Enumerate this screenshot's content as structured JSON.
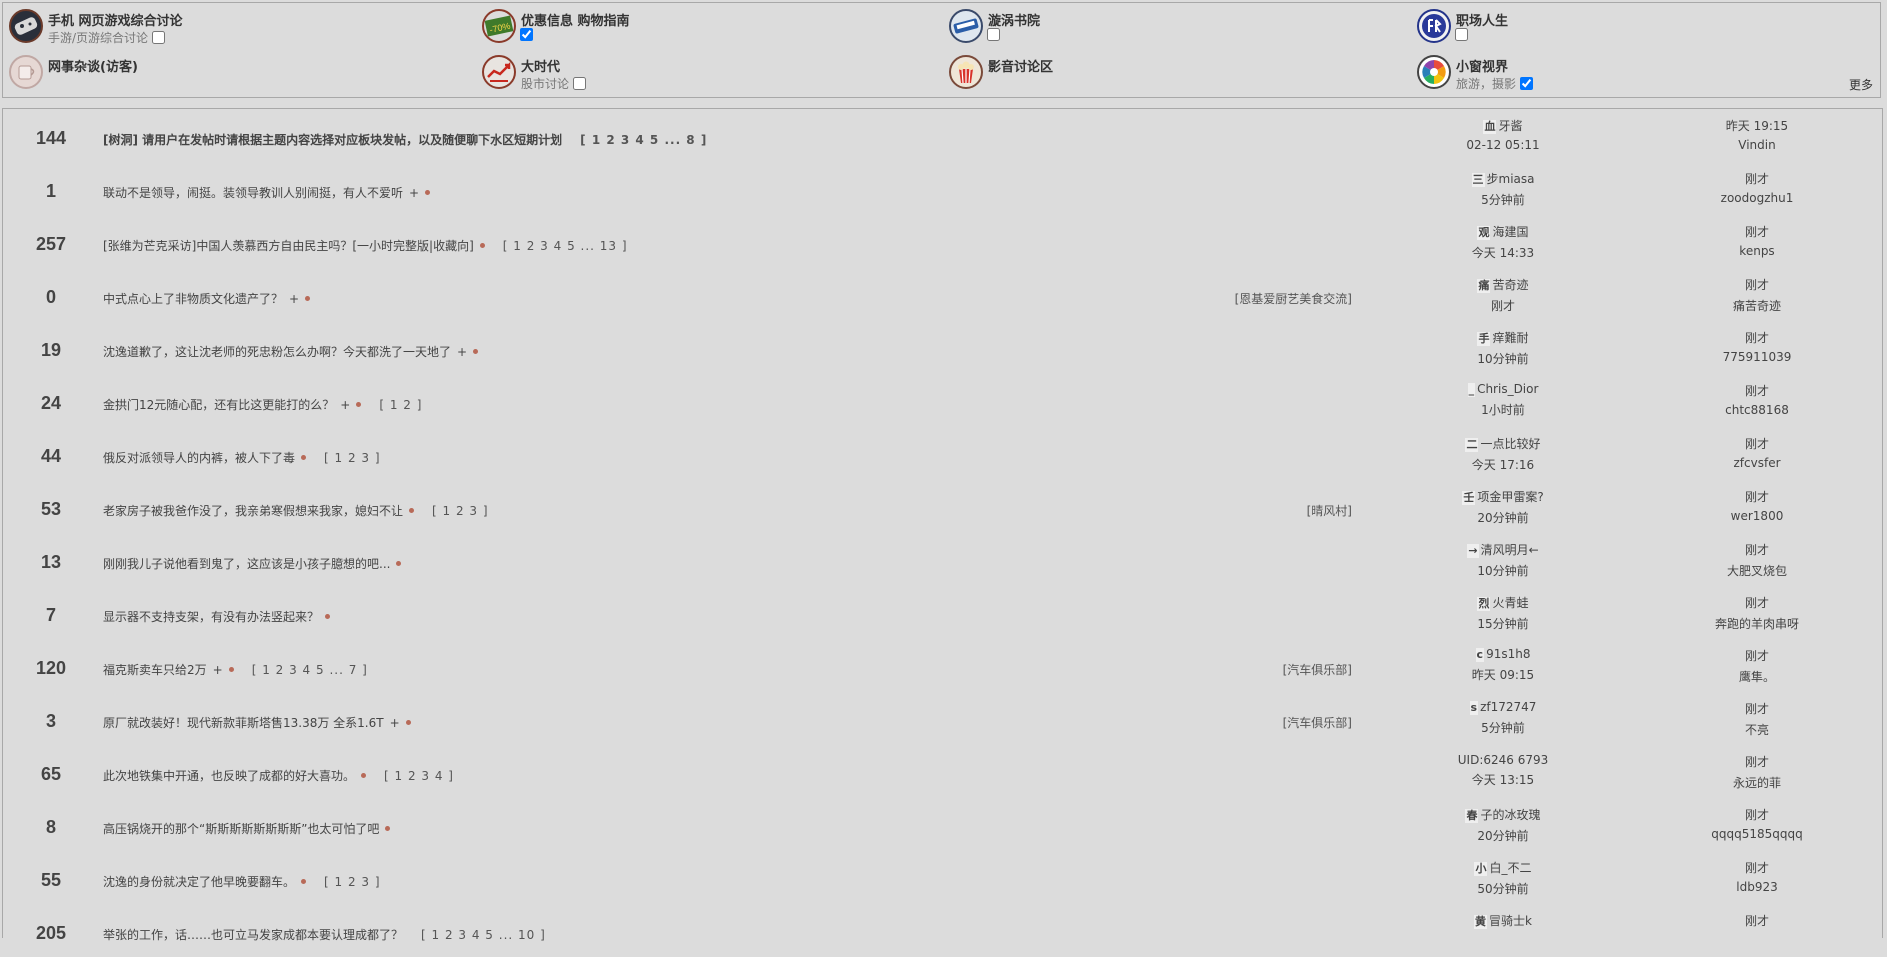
{
  "forums": [
    {
      "name": "手机 网页游戏综合讨论",
      "sub": "手游/页游综合讨论",
      "checked": false,
      "icon": "gamepad-icon"
    },
    {
      "name": "优惠信息 购物指南",
      "sub": "",
      "checked": true,
      "icon": "discount-tag-icon",
      "badge": "-70%"
    },
    {
      "name": "漩涡书院",
      "sub": "",
      "checked": false,
      "icon": "book-icon"
    },
    {
      "name": "职场人生",
      "sub": "",
      "checked": false,
      "icon": "career-icon"
    },
    {
      "name": "网事杂谈(访客)",
      "sub": "",
      "icon": "cup-icon"
    },
    {
      "name": "大时代",
      "sub": "股市讨论",
      "checked": false,
      "icon": "bull-icon"
    },
    {
      "name": "影音讨论区",
      "sub": "",
      "icon": "popcorn-icon"
    },
    {
      "name": "小窗视界",
      "sub": "旅游，摄影",
      "checked": true,
      "icon": "aperture-icon"
    }
  ],
  "more_label": "更多",
  "topics": [
    {
      "count": "144",
      "title": "[树洞] 请用户在发帖时请根据主题内容选择对应板块发帖，以及随便聊下水区短期计划",
      "bold": true,
      "plus": false,
      "dot": false,
      "pages": "[ 1 2 3 4 5 ... 8 ]",
      "tag": "",
      "author_av": "血",
      "author": "牙酱",
      "time": "02-12 05:11",
      "reply_time": "昨天 19:15",
      "reply_av": "V",
      "replier": "indin"
    },
    {
      "count": "1",
      "title": "联动不是领导，闹挺。装领导教训人别闹挺，有人不爱听",
      "plus": true,
      "dot": true,
      "pages": "",
      "tag": "",
      "author_av": "三",
      "author": "步miasa",
      "time": "5分钟前",
      "reply_time": "刚才",
      "reply_av": "z",
      "replier": "oodogzhu1"
    },
    {
      "count": "257",
      "title": "[张维为芒克采访]中国人羡慕西方自由民主吗？[一小时完整版|收藏向]",
      "plus": false,
      "dot": true,
      "pages": "[ 1 2 3 4 5 ... 13 ]",
      "tag": "",
      "author_av": "观",
      "author": "海建国",
      "time": "今天 14:33",
      "reply_time": "刚才",
      "reply_av": "k",
      "replier": "enps"
    },
    {
      "count": "0",
      "title": "中式点心上了非物质文化遗产了？",
      "plus": true,
      "dot": true,
      "pages": "",
      "tag": "[恩基爱厨艺美食交流]",
      "author_av": "痛",
      "author": "苦奇迹",
      "time": "刚才",
      "reply_time": "刚才",
      "reply_av": "痛",
      "replier": "苦奇迹"
    },
    {
      "count": "19",
      "title": "沈逸道歉了，这让沈老师的死忠粉怎么办啊？今天都洗了一天地了",
      "plus": true,
      "dot": true,
      "pages": "",
      "tag": "",
      "author_av": "手",
      "author": "痒難耐",
      "time": "10分钟前",
      "reply_time": "刚才",
      "reply_av": "7",
      "replier": "75911039"
    },
    {
      "count": "24",
      "title": "金拱门12元随心配，还有比这更能打的么？",
      "plus": true,
      "dot": true,
      "pages": "[ 1 2 ]",
      "tag": "",
      "author_av": "_",
      "author": "Chris_Dior",
      "time": "1小时前",
      "reply_time": "刚才",
      "reply_av": "c",
      "replier": "htc88168"
    },
    {
      "count": "44",
      "title": "俄反对派领导人的内裤，被人下了毒",
      "plus": false,
      "dot": true,
      "pages": "[ 1 2 3 ]",
      "tag": "",
      "author_av": "二",
      "author": "一点比较好",
      "time": "今天 17:16",
      "reply_time": "刚才",
      "reply_av": "z",
      "replier": "fcvsfer"
    },
    {
      "count": "53",
      "title": "老家房子被我爸作没了，我亲弟寒假想来我家，媳妇不让",
      "plus": false,
      "dot": true,
      "pages": "[ 1 2 3 ]",
      "tag": "[晴风村]",
      "author_av": "壬",
      "author": "项金甲雷案?",
      "time": "20分钟前",
      "reply_time": "刚才",
      "reply_av": "w",
      "replier": "er1800"
    },
    {
      "count": "13",
      "title": "刚刚我儿子说他看到鬼了，这应该是小孩子臆想的吧...",
      "plus": false,
      "dot": true,
      "pages": "",
      "tag": "",
      "author_av": "→",
      "author": "清风明月←",
      "time": "10分钟前",
      "reply_time": "刚才",
      "reply_av": "大",
      "replier": "肥叉烧包"
    },
    {
      "count": "7",
      "title": "显示器不支持支架，有没有办法竖起来？",
      "plus": false,
      "dot": true,
      "pages": "",
      "tag": "",
      "author_av": "烈",
      "author": "火青蛙",
      "time": "15分钟前",
      "reply_time": "刚才",
      "reply_av": "奔",
      "replier": "跑的羊肉串呀"
    },
    {
      "count": "120",
      "title": "福克斯卖车只给2万",
      "plus": true,
      "dot": true,
      "pages": "[ 1 2 3 4 5 ... 7 ]",
      "tag": "[汽车俱乐部]",
      "author_av": "c",
      "author": "91s1h8",
      "time": "昨天 09:15",
      "reply_time": "刚才",
      "reply_av": "鹰",
      "replier": "隼。"
    },
    {
      "count": "3",
      "title": "原厂就改装好！现代新款菲斯塔售13.38万 全系1.6T",
      "plus": true,
      "dot": true,
      "pages": "",
      "tag": "[汽车俱乐部]",
      "author_av": "s",
      "author": "zf172747",
      "time": "5分钟前",
      "reply_time": "刚才",
      "reply_av": "不",
      "replier": "亮"
    },
    {
      "count": "65",
      "title": "此次地铁集中开通，也反映了成都的好大喜功。",
      "plus": false,
      "dot": true,
      "pages": "[ 1 2 3 4 ]",
      "tag": "",
      "author_av": "",
      "author": "UID:6246 6793",
      "time": "今天 13:15",
      "reply_time": "刚才",
      "reply_av": "永",
      "replier": "远的菲"
    },
    {
      "count": "8",
      "title": "高压锅烧开的那个“斯斯斯斯斯斯斯斯”也太可怕了吧",
      "plus": false,
      "dot": true,
      "pages": "",
      "tag": "",
      "author_av": "春",
      "author": "子的冰玫瑰",
      "time": "20分钟前",
      "reply_time": "刚才",
      "reply_av": "q",
      "replier": "qqq5185qqqq"
    },
    {
      "count": "55",
      "title": "沈逸的身份就决定了他早晚要翻车。",
      "plus": false,
      "dot": true,
      "pages": "[ 1 2 3 ]",
      "tag": "",
      "author_av": "小",
      "author": "白_不二",
      "time": "50分钟前",
      "reply_time": "刚才",
      "reply_av": "l",
      "replier": "db923"
    },
    {
      "count": "205",
      "title": "举张的工作，话……也可立马发家成都本要认理成都了？",
      "plus": false,
      "dot": false,
      "pages": "[ 1 2 3 4 5 ... 10 ]",
      "tag": "",
      "author_av": "黄",
      "author": "冒骑士k",
      "time": "",
      "reply_time": "刚才",
      "reply_av": "",
      "replier": ""
    }
  ]
}
